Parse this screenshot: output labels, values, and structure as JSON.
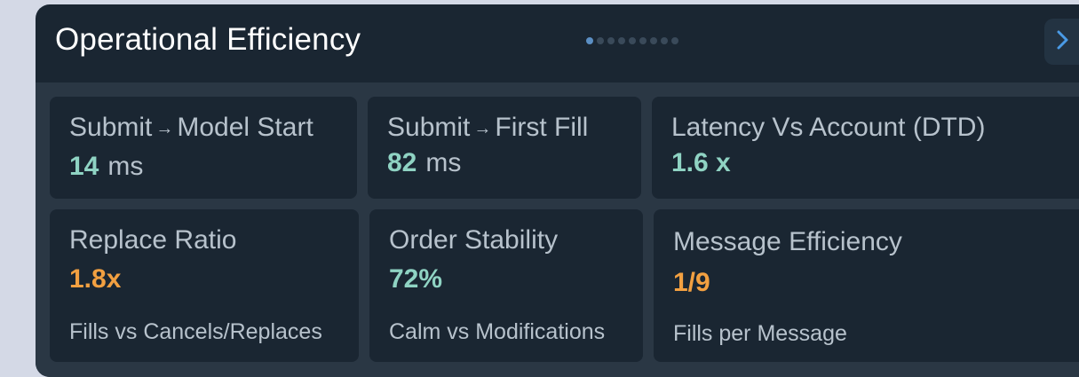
{
  "header": {
    "title": "Operational Efficiency",
    "page_dots": 9,
    "active_dot": 0,
    "next_icon": "chevron-right-icon"
  },
  "colors": {
    "good": "#8fd3c3",
    "warn": "#f2a041",
    "accent": "#5b8fc4"
  },
  "metrics": {
    "submit_model": {
      "label_a": "Submit",
      "label_b": "Model Start",
      "value": "14",
      "unit": "ms"
    },
    "submit_fill": {
      "label_a": "Submit",
      "label_b": "First Fill",
      "value": "82",
      "unit": "ms"
    },
    "latency": {
      "label": "Latency Vs Account (DTD)",
      "value": "1.6 x"
    },
    "replace_ratio": {
      "label": "Replace Ratio",
      "value": "1.8x",
      "sub": "Fills vs Cancels/Replaces"
    },
    "order_stability": {
      "label": "Order Stability",
      "value": "72%",
      "sub": "Calm vs Modifications"
    },
    "message_eff": {
      "label": "Message Efficiency",
      "value": "1/9",
      "sub": "Fills per Message"
    }
  }
}
